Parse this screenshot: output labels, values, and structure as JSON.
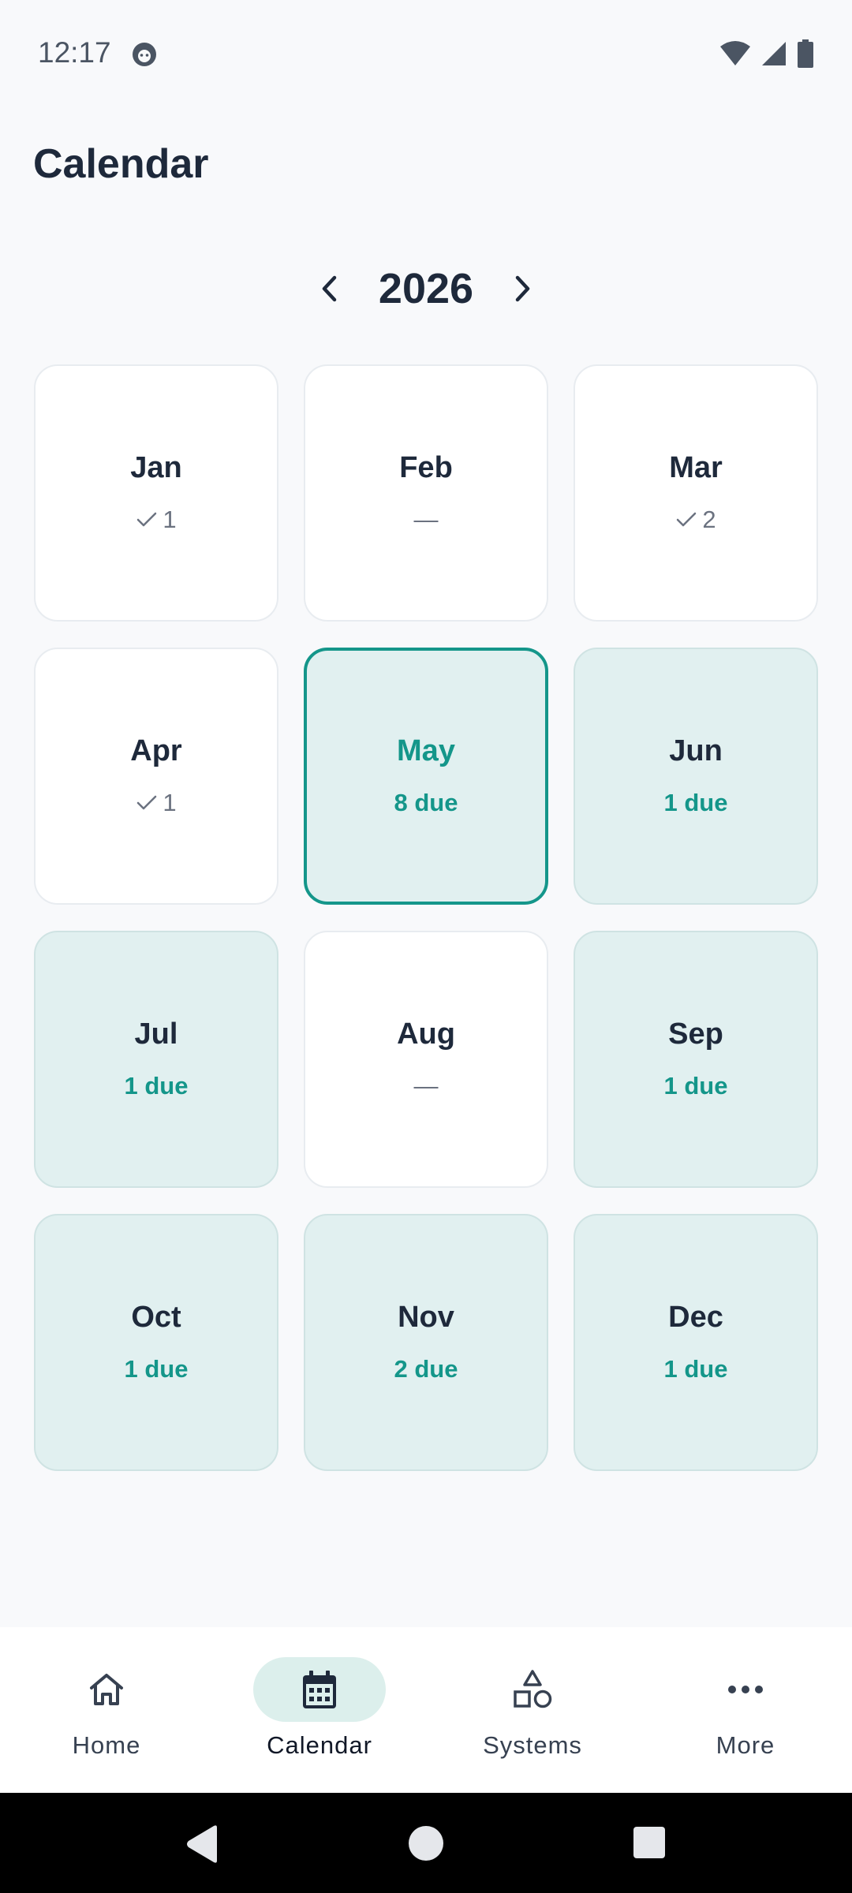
{
  "status_bar": {
    "time": "12:17"
  },
  "header": {
    "title": "Calendar"
  },
  "year_nav": {
    "year": "2026"
  },
  "months": [
    {
      "name": "Jan",
      "status": "done",
      "sub": "1"
    },
    {
      "name": "Feb",
      "status": "none",
      "sub": "—"
    },
    {
      "name": "Mar",
      "status": "done",
      "sub": "2"
    },
    {
      "name": "Apr",
      "status": "done",
      "sub": "1"
    },
    {
      "name": "May",
      "status": "selected",
      "sub": "8 due"
    },
    {
      "name": "Jun",
      "status": "due",
      "sub": "1 due"
    },
    {
      "name": "Jul",
      "status": "due",
      "sub": "1 due"
    },
    {
      "name": "Aug",
      "status": "none",
      "sub": "—"
    },
    {
      "name": "Sep",
      "status": "due",
      "sub": "1 due"
    },
    {
      "name": "Oct",
      "status": "due",
      "sub": "1 due"
    },
    {
      "name": "Nov",
      "status": "due",
      "sub": "2 due"
    },
    {
      "name": "Dec",
      "status": "due",
      "sub": "1 due"
    }
  ],
  "bottom_nav": {
    "items": [
      {
        "label": "Home",
        "icon": "home-icon"
      },
      {
        "label": "Calendar",
        "icon": "calendar-icon",
        "active": true
      },
      {
        "label": "Systems",
        "icon": "shapes-icon"
      },
      {
        "label": "More",
        "icon": "more-horizontal-icon"
      }
    ]
  },
  "colors": {
    "accent": "#14968a",
    "due_background": "#e1f0f0",
    "card_background": "#ffffff",
    "page_background": "#f8f9fb"
  }
}
